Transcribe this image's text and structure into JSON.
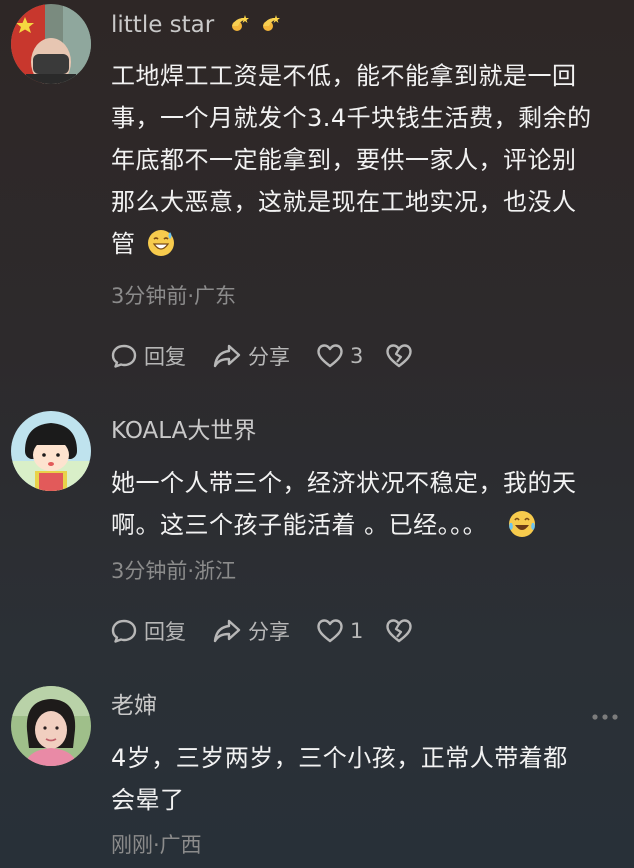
{
  "comments": [
    {
      "username": "little star",
      "text_lines": [
        "工地焊工工资是不低，能不能拿到就是一回",
        "事，一个月就发个3.4千块钱生活费，剩余的",
        "年底都不一定能拿到，要供一家人，评论别",
        "那么大恶意，这就是现在工地实况，也没人",
        "管"
      ],
      "time_location": "3分钟前·广东",
      "reply_label": "回复",
      "share_label": "分享",
      "likes": "3",
      "colors": {
        "name": "#c9c9c9"
      }
    },
    {
      "username": "KOALA大世界",
      "text_lines": [
        "她一个人带三个，经济状况不稳定，我的天",
        "啊。这三个孩子能活着 。已经。。。"
      ],
      "time_location": "3分钟前·浙江",
      "reply_label": "回复",
      "share_label": "分享",
      "likes": "1"
    },
    {
      "username": "老婶",
      "text_lines": [
        "4岁，三岁两岁，三个小孩，正常人带着都",
        "会晕了"
      ],
      "time_location": "刚刚·广西",
      "more_icon": "more-dots-icon"
    }
  ]
}
